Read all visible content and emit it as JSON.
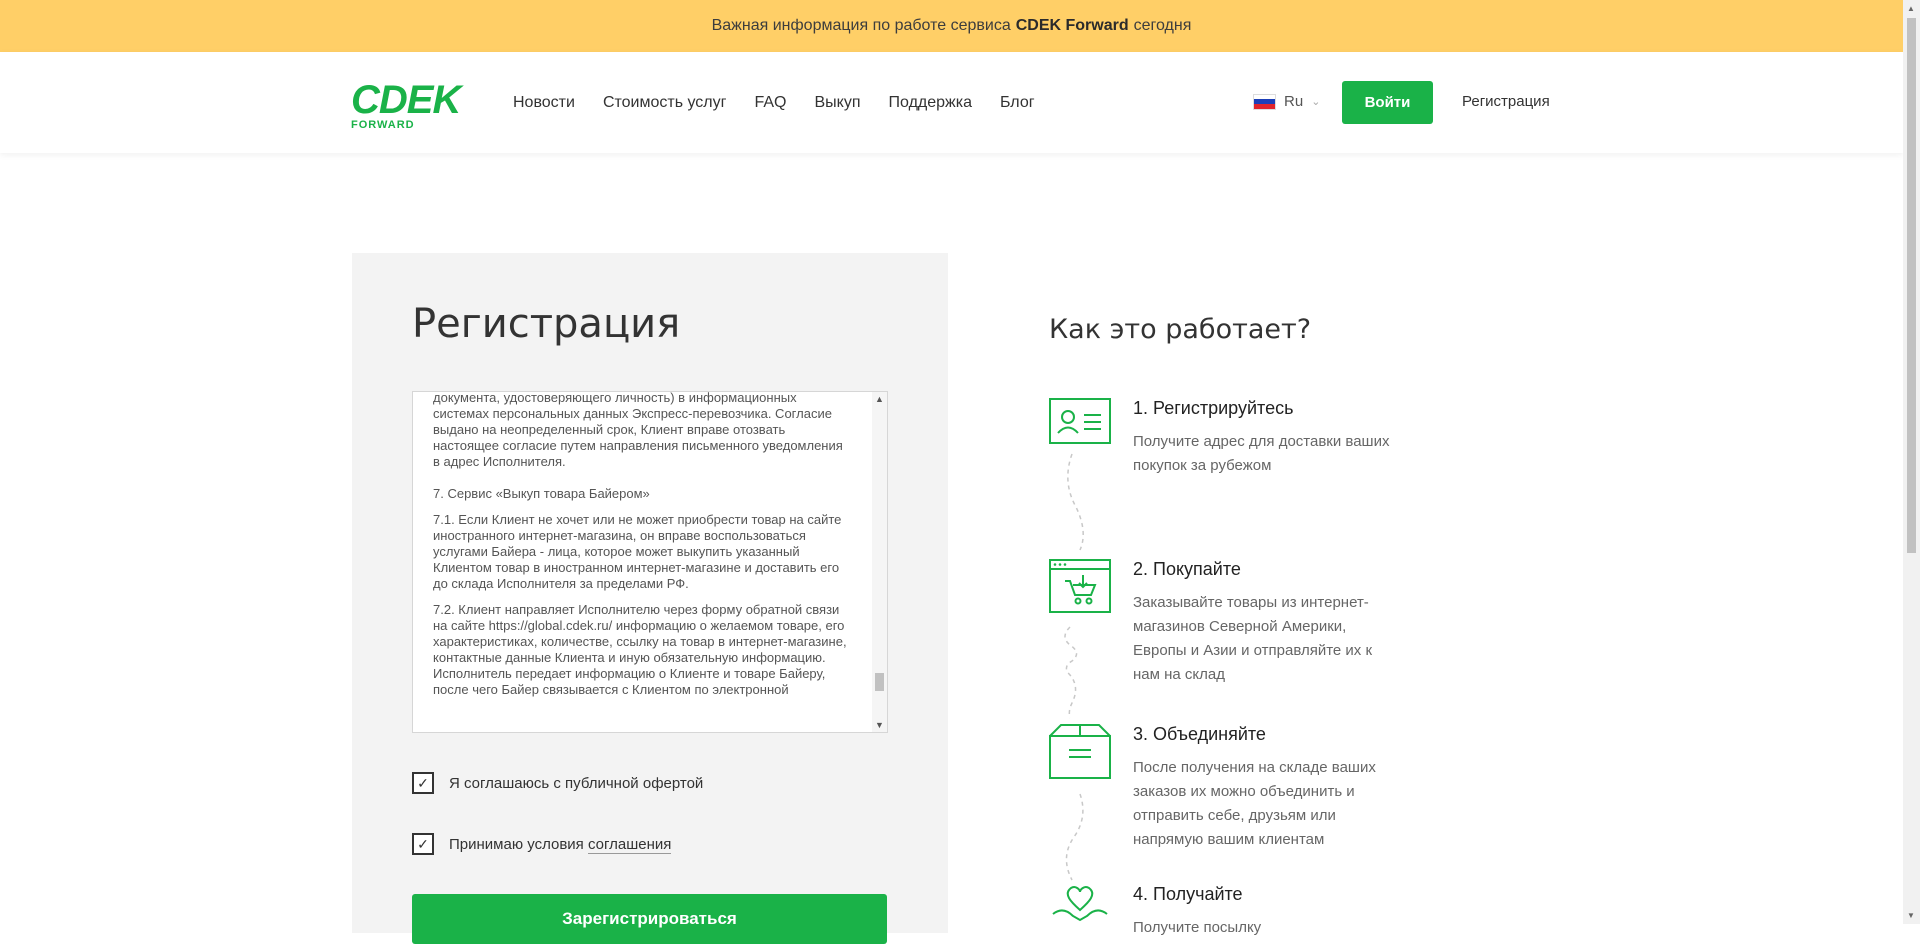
{
  "banner": {
    "text_before": "Важная информация по работе сервиса",
    "highlight": "CDEK Forward",
    "text_after": "сегодня"
  },
  "header": {
    "logo_main": "CDEK",
    "logo_sub": "FORWARD",
    "nav": [
      {
        "label": "Новости"
      },
      {
        "label": "Стоимость услуг"
      },
      {
        "label": "FAQ"
      },
      {
        "label": "Выкуп"
      },
      {
        "label": "Поддержка"
      },
      {
        "label": "Блог"
      }
    ],
    "language": "Ru",
    "login_label": "Войти",
    "register_label": "Регистрация"
  },
  "registration": {
    "title": "Регистрация",
    "terms_paragraphs": [
      "документа, удостоверяющего личность) в информационных системах персональных данных Экспресс-перевозчика. Согласие выдано на неопределенный срок, Клиент вправе отозвать настоящее согласие путем направления письменного уведомления в адрес Исполнителя.",
      "7. Сервис «Выкуп товара Байером»",
      "7.1. Если Клиент не хочет или не может приобрести товар на сайте иностранного интернет-магазина, он вправе воспользоваться услугами Байера - лица, которое может выкупить указанный Клиентом товар в иностранном интернет-магазине и доставить его до склада Исполнителя за пределами РФ.",
      "7.2. Клиент направляет Исполнителю через форму обратной связи на сайте https://global.cdek.ru/ информацию о желаемом товаре, его характеристиках, количестве, ссылку на товар в интернет-магазине, контактные данные Клиента и иную обязательную информацию. Исполнитель передает информацию о Клиенте и товаре Байеру, после чего Байер связывается с Клиентом по электронной"
    ],
    "checkbox_offer": "Я соглашаюсь с публичной офертой",
    "checkbox_terms_prefix": "Принимаю условия",
    "checkbox_terms_link": "соглашения",
    "submit_label": "Зарегистрироваться"
  },
  "how_it_works": {
    "title": "Как это работает?",
    "steps": [
      {
        "title": "1. Регистрируйтесь",
        "text": "Получите адрес для доставки ваших покупок за рубежом",
        "icon": "id-card-icon"
      },
      {
        "title": "2. Покупайте",
        "text": "Заказывайте товары из интернет-магазинов Северной Америки, Европы и Азии и отправляйте их к нам на склад",
        "icon": "shopping-cart-icon"
      },
      {
        "title": "3. Объединяйте",
        "text": "После получения на складе ваших заказов их можно объединить и отправить себе, друзьям или напрямую вашим клиентам",
        "icon": "box-icon"
      },
      {
        "title": "4. Получайте",
        "text": "Получите посылку",
        "icon": "heart-hands-icon"
      }
    ]
  },
  "colors": {
    "banner": "#ffcf67",
    "brand_green": "#1ab248",
    "panel_bg": "#f3f3f3"
  }
}
